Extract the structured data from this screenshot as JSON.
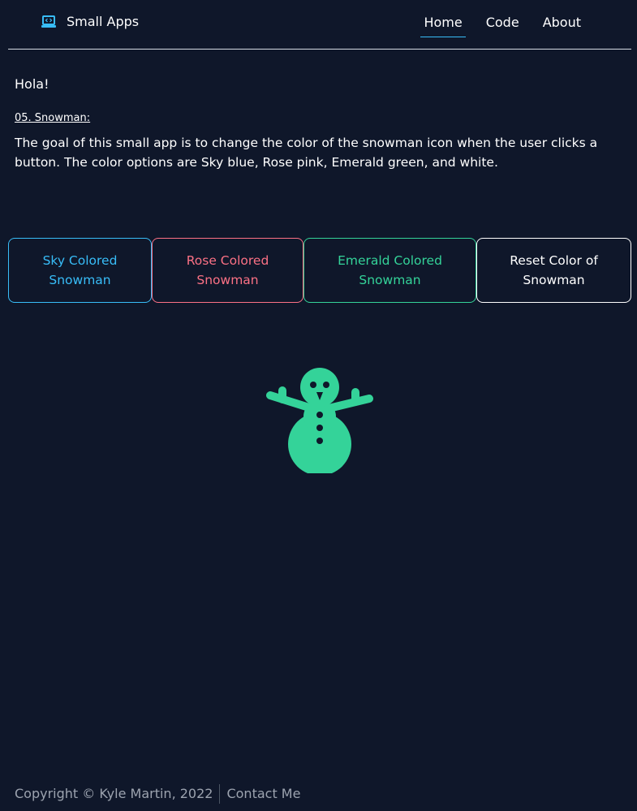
{
  "header": {
    "brand_title": "Small Apps",
    "brand_icon": "laptop-code-icon",
    "nav": [
      {
        "label": "Home",
        "active": true
      },
      {
        "label": "Code",
        "active": false
      },
      {
        "label": "About",
        "active": false
      }
    ]
  },
  "intro": {
    "greeting": "Hola!",
    "section_title": "05. Snowman:",
    "description": "The goal of this small app is to change the color of the snowman icon when the user clicks a button. The color options are Sky blue, Rose pink, Emerald green, and white."
  },
  "buttons": {
    "sky": "Sky Colored Snowman",
    "rose": "Rose Colored Snowman",
    "emerald": "Emerald Colored Snowman",
    "reset": "Reset Color of Snowman"
  },
  "snowman": {
    "icon": "snowman-icon",
    "color": "#34d399"
  },
  "footer": {
    "copyright": "Copyright © Kyle Martin, 2022",
    "contact": "Contact Me"
  },
  "colors": {
    "background": "#0f172a",
    "sky": "#38bdf8",
    "rose": "#fb7185",
    "emerald": "#34d399",
    "white": "#ffffff"
  }
}
